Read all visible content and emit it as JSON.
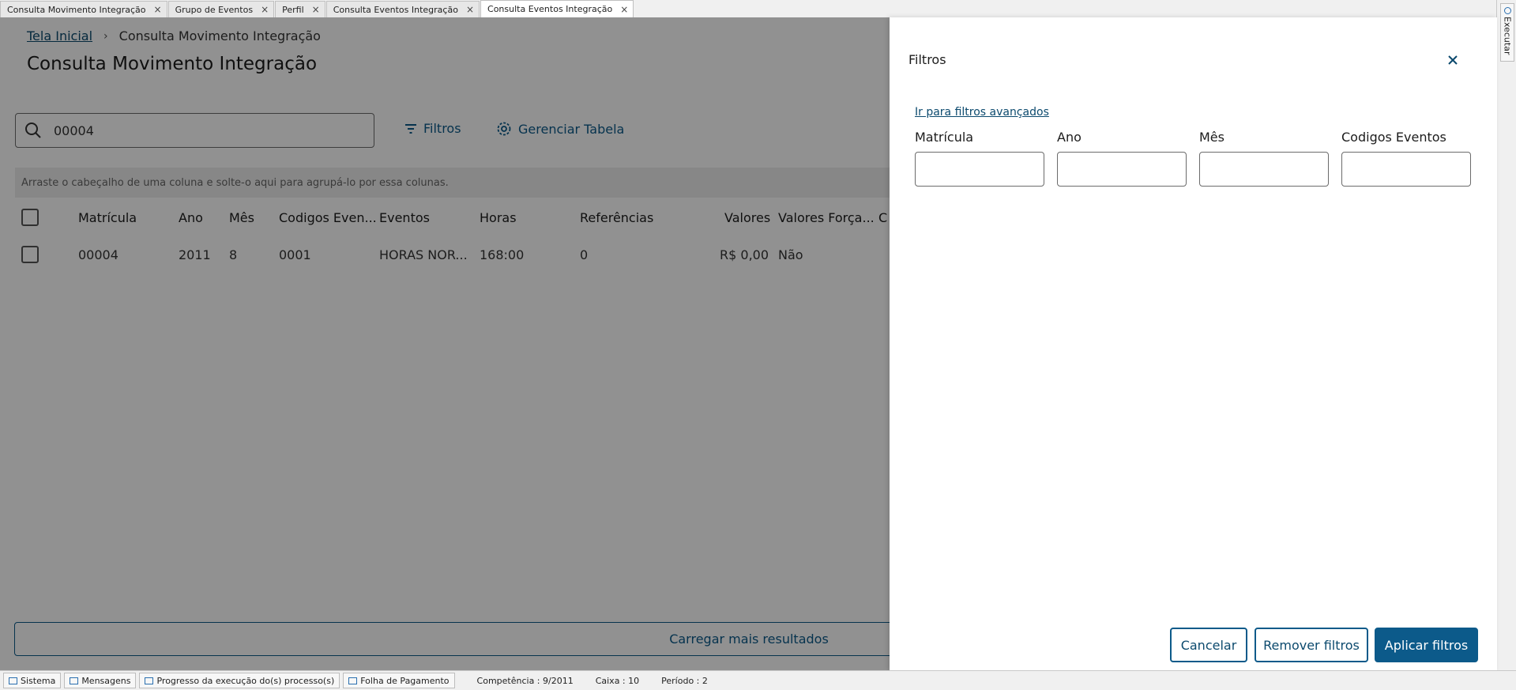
{
  "tabs": [
    {
      "label": "Consulta Movimento Integração",
      "close": "×"
    },
    {
      "label": "Grupo de Eventos",
      "close": "×"
    },
    {
      "label": "Perfil",
      "close": "×"
    },
    {
      "label": "Consulta Eventos Integração",
      "close": "×"
    },
    {
      "label": "Consulta Eventos Integração",
      "close": "×",
      "active": true
    }
  ],
  "side_tab": {
    "label": "Executar"
  },
  "breadcrumb": {
    "home": "Tela Inicial",
    "separator": "›",
    "current": "Consulta Movimento Integração"
  },
  "page_title": "Consulta Movimento Integração",
  "search": {
    "value": "00004",
    "icon": "search-icon"
  },
  "toolbar": {
    "filters_label": "Filtros",
    "manage_table_label": "Gerenciar Tabela"
  },
  "group_bar": {
    "text": "Arraste o cabeçalho de uma coluna e solte-o aqui para agrupá-lo por essa colunas."
  },
  "table": {
    "columns": [
      "Matrícula",
      "Ano",
      "Mês",
      "Codigos Even...",
      "Eventos",
      "Horas",
      "Referências",
      "Valores",
      "Valores Força...",
      "C"
    ],
    "rows": [
      {
        "matricula": "00004",
        "ano": "2011",
        "mes": "8",
        "codigos": "0001",
        "eventos": "HORAS NOR...",
        "horas": "168:00",
        "referencias": "0",
        "valores": "R$ 0,00",
        "forcados": "Não"
      }
    ]
  },
  "load_more": {
    "label": "Carregar mais resultados"
  },
  "drawer": {
    "title": "Filtros",
    "advanced_link": "Ir para filtros avançados",
    "fields": [
      {
        "label": "Matrícula",
        "value": ""
      },
      {
        "label": "Ano",
        "value": ""
      },
      {
        "label": "Mês",
        "value": ""
      },
      {
        "label": "Codigos Eventos",
        "value": ""
      }
    ],
    "buttons": {
      "cancel": "Cancelar",
      "remove": "Remover filtros",
      "apply": "Aplicar filtros"
    }
  },
  "statusbar": {
    "items": [
      "Sistema",
      "Mensagens",
      "Progresso da execução do(s) processo(s)",
      "Folha de Pagamento"
    ],
    "competencia": "Competência : 9/2011",
    "caixa": "Caixa : 10",
    "periodo": "Período : 2"
  },
  "colors": {
    "accent": "#0c5a8a",
    "link": "#0c4a6e",
    "overlay": "rgba(0,0,0,0.43)"
  }
}
